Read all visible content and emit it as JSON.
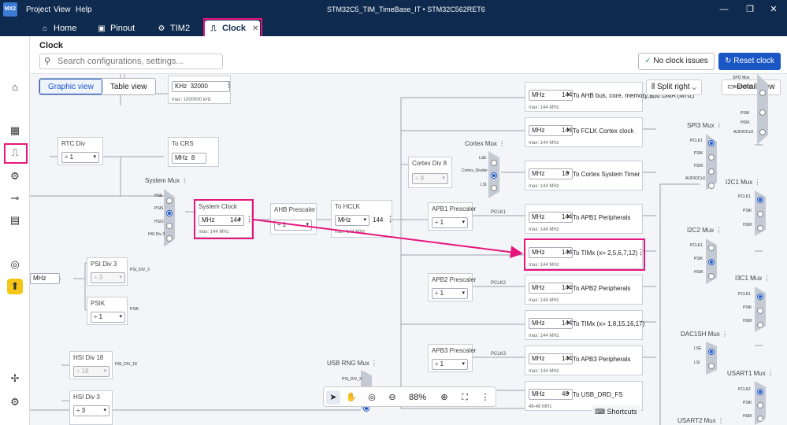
{
  "window": {
    "logo": "MX2",
    "menus": [
      "Project",
      "View",
      "Help"
    ],
    "title": "STM32C5_TIM_TimeBase_IT  •  STM32C562RET6",
    "controls": [
      "—",
      "❐",
      "✕"
    ]
  },
  "tabs": [
    {
      "label": "Home",
      "icon": "⌂"
    },
    {
      "label": "Pinout",
      "icon": "▣"
    },
    {
      "label": "TIM2",
      "icon": "⚙"
    },
    {
      "label": "Clock",
      "icon": "⎍",
      "close": "✕"
    }
  ],
  "header": {
    "title": "Clock",
    "search_placeholder": "Search configurations, settings...",
    "no_issues": "No clock issues",
    "reset": "Reset clock"
  },
  "view": {
    "graphic": "Graphic view",
    "table": "Table view",
    "split": "Split right",
    "detail": "Detail view"
  },
  "zoom": {
    "level": "88%"
  },
  "shortcuts": "Shortcuts",
  "nodes": {
    "top": {
      "unit": "KHz",
      "value": "32000",
      "max": "max: 1000000 kHz"
    },
    "rtc": {
      "label": "RTC Div",
      "value": "÷ 1"
    },
    "crs": {
      "label": "To CRS",
      "unit": "MHz",
      "value": "8"
    },
    "mhzsel": {
      "unit": "MHz"
    },
    "psi3": {
      "label": "PSI Div 3",
      "value": "÷ 3"
    },
    "psik": {
      "label": "PSIK",
      "value": "÷ 1"
    },
    "hsi18": {
      "label": "HSI Div 18",
      "value": "÷ 18"
    },
    "hsi3": {
      "label": "HSI Div 3",
      "value": "÷ 3"
    },
    "sysclk": {
      "label": "System Clock",
      "unit": "MHz",
      "value": "144",
      "max": "max: 144 MHz"
    },
    "ahb": {
      "label": "AHB Prescaler",
      "value": "÷ 1"
    },
    "hclk": {
      "label": "To HCLK",
      "unit": "MHz",
      "value": "144",
      "max": "max: 144 MHz"
    },
    "cortexdiv": {
      "label": "Cortex Div 8",
      "value": "÷ 8"
    },
    "apb1": {
      "label": "APB1 Prescaler",
      "value": "÷ 1"
    },
    "apb2": {
      "label": "APB2 Prescaler",
      "value": "÷ 1"
    },
    "apb3": {
      "label": "APB3 Prescaler",
      "value": "÷ 1"
    }
  },
  "outputs": [
    {
      "unit": "MHz",
      "value": "144",
      "desc": "To AHB bus, core, memory and DMA (MHz)",
      "max": "max: 144 MHz"
    },
    {
      "unit": "MHz",
      "value": "144",
      "desc": "To FCLK Cortex clock",
      "max": "max: 144 MHz"
    },
    {
      "unit": "MHz",
      "value": "18",
      "desc": "To Cortex System Timer",
      "max": "max: 144 MHz"
    },
    {
      "unit": "MHz",
      "value": "144",
      "desc": "To APB1 Peripherals",
      "max": "max: 144 MHz"
    },
    {
      "unit": "MHz",
      "value": "144",
      "desc": "To TIMx (x= 2,5,6,7,12)",
      "max": "max: 144 MHz"
    },
    {
      "unit": "MHz",
      "value": "144",
      "desc": "To APB2 Peripherals",
      "max": "max: 144 MHz"
    },
    {
      "unit": "MHz",
      "value": "144",
      "desc": "To TIMx (x= 1,8,15,16,17)",
      "max": "max: 144 MHz"
    },
    {
      "unit": "MHz",
      "value": "144",
      "desc": "To APB3 Peripherals",
      "max": "max: 144 MHz"
    },
    {
      "unit": "MHz",
      "value": "48",
      "desc": "To USB_DRD_FS",
      "max": "48-48 MHz"
    }
  ],
  "muxes": {
    "system": {
      "label": "System Mux",
      "inputs": [
        "HSE",
        "PSIS",
        "HSIS",
        "HSI Div 3"
      ]
    },
    "cortex": {
      "label": "Cortex Mux",
      "inputs": [
        "LSE",
        "Cortex_Divider",
        "LSI"
      ]
    },
    "usbrng": {
      "label": "USB RNG Mux",
      "inputs": [
        "PSI_DIV_3"
      ]
    },
    "spi2": {
      "label": "SPI2 Mux",
      "inputs": [
        "AUDIOCLK",
        "PSIK",
        "HSIK",
        "AUDIOCLK"
      ]
    },
    "spi3": {
      "label": "SPI3 Mux",
      "inputs": [
        "PCLK1",
        "PSIK",
        "HSIK",
        "AUDIOCLK"
      ]
    },
    "i2c1": {
      "label": "I2C1 Mux",
      "inputs": [
        "PCLK1",
        "PSIK",
        "HSIK"
      ]
    },
    "i2c2": {
      "label": "I2C2 Mux",
      "inputs": [
        "PCLK1",
        "PSIK",
        "HSIK"
      ]
    },
    "i3c1": {
      "label": "I3C1 Mux",
      "inputs": [
        "PCLK1",
        "PSIK",
        "HSIK"
      ]
    },
    "dac1sh": {
      "label": "DAC1SH Mux",
      "inputs": [
        "LSE",
        "LSI"
      ]
    },
    "usart1": {
      "label": "USART1 Mux",
      "inputs": [
        "PCLK2",
        "PSIK",
        "HSIK"
      ]
    },
    "usart2": {
      "label": "USART2 Mux"
    }
  },
  "signals": {
    "psi_div3": "PSI_DIV_3",
    "psik": "PSIK",
    "hsi_div18": "HSI_DIV_18",
    "pclk1": "PCLK1",
    "pclk2": "PCLK2",
    "pclk3": "PCLK3"
  },
  "sidebar": [
    {
      "icon": "⌂"
    },
    {
      "icon": "▦"
    },
    {
      "icon": "⎍"
    },
    {
      "icon": "⚙"
    },
    {
      "icon": "⊸"
    },
    {
      "icon": "▤"
    },
    {
      "icon": "◎"
    },
    {
      "icon": "⬆"
    },
    {
      "icon": "✢"
    },
    {
      "icon": "⚙"
    }
  ],
  "colors": {
    "accent": "#1a56c4",
    "highlight": "#e6157e",
    "titlebar": "#0e2a4e"
  }
}
